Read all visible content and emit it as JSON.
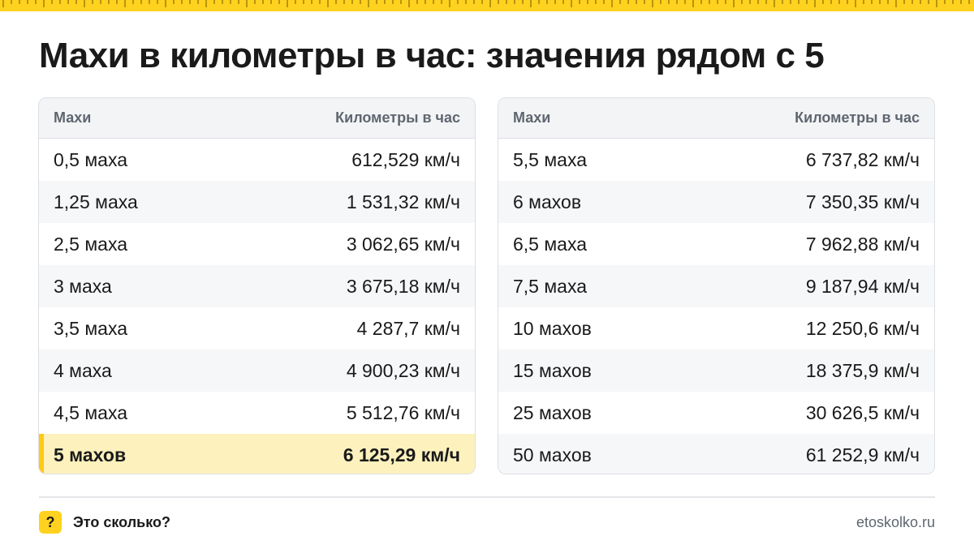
{
  "title": "Махи в километры в час: значения рядом с 5",
  "tables": [
    {
      "headers": [
        "Махи",
        "Километры в час"
      ],
      "rows": [
        [
          "0,5 маха",
          "612,529 км/ч"
        ],
        [
          "1,25 маха",
          "1 531,32 км/ч"
        ],
        [
          "2,5 маха",
          "3 062,65 км/ч"
        ],
        [
          "3 маха",
          "3 675,18 км/ч"
        ],
        [
          "3,5 маха",
          "4 287,7 км/ч"
        ],
        [
          "4 маха",
          "4 900,23 км/ч"
        ],
        [
          "4,5 маха",
          "5 512,76 км/ч"
        ],
        [
          "5 махов",
          "6 125,29 км/ч"
        ]
      ],
      "highlighted_row": 7
    },
    {
      "headers": [
        "Махи",
        "Километры в час"
      ],
      "rows": [
        [
          "5,5 маха",
          "6 737,82 км/ч"
        ],
        [
          "6 махов",
          "7 350,35 км/ч"
        ],
        [
          "6,5 маха",
          "7 962,88 км/ч"
        ],
        [
          "7,5 маха",
          "9 187,94 км/ч"
        ],
        [
          "10 махов",
          "12 250,6 км/ч"
        ],
        [
          "15 махов",
          "18 375,9 км/ч"
        ],
        [
          "25 махов",
          "30 626,5 км/ч"
        ],
        [
          "50 махов",
          "61 252,9 км/ч"
        ]
      ]
    }
  ],
  "footer": {
    "badge": "?",
    "brand": "Это сколько?",
    "site": "etoskolko.ru"
  },
  "colors": {
    "accent": "#ffd21f",
    "highlight_bg": "#fdf1bd",
    "header_bg": "#f3f4f6"
  }
}
